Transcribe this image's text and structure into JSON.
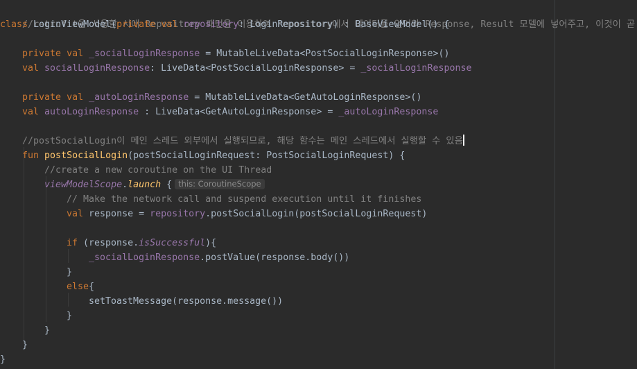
{
  "editor": {
    "background": "#2b2b2b",
    "colors": {
      "comment": "#808080",
      "keyword": "#cc7832",
      "property": "#9876aa",
      "function": "#ffc66d",
      "text": "#a9b7c6"
    },
    "lines": {
      "l1_comment": "//retrofit을 사용할 시에 Repository 패턴을 이용하여 repository에서 데이터를 얻어와 Response, Result 모델에 넣어주고, 이것이 곧 뷰모델이 됨",
      "l2_class_kw": "class",
      "l2_class_name": "LoginViewModel(",
      "l2_private": "private",
      "l2_val": "val",
      "l2_repo": "repository",
      "l2_rest": ": LoginRepository) : BaseViewModel() {",
      "l3_private": "private",
      "l3_val": "val",
      "l3_name": "_socialLoginResponse",
      "l3_rest": " = MutableLiveData<PostSocialLoginResponse>()",
      "l4_val": "val",
      "l4_name": "socialLoginResponse",
      "l4_mid": ": LiveData<PostSocialLoginResponse> = ",
      "l4_ref": "_socialLoginResponse",
      "l5_private": "private",
      "l5_val": "val",
      "l5_name": "_autoLoginResponse",
      "l5_rest": " = MutableLiveData<GetAutoLoginResponse>()",
      "l6_val": "val",
      "l6_name": "autoLoginResponse",
      "l6_mid": " : LiveData<GetAutoLoginResponse> = ",
      "l6_ref": "_autoLoginResponse",
      "l7_comment": "//postSocialLogin이 메인 스레드 외부에서 실행되므로, 해당 함수는 메인 스레드에서 실행할 수 있음",
      "l8_fun": "fun",
      "l8_name": "postSocialLogin",
      "l8_rest": "(postSocialLoginRequest: PostSocialLoginRequest) {",
      "l9_comment": "//create a new coroutine on the UI Thread",
      "l10_scope": "viewModelScope",
      "l10_dot": ".",
      "l10_launch": "launch",
      "l10_brace": " {",
      "l10_hint": "this: CoroutineScope",
      "l11_comment": "// Make the network call and suspend execution until it finishes",
      "l12_val": "val",
      "l12_mid": " response = ",
      "l12_repo": "repository",
      "l12_rest": ".postSocialLogin(postSocialLoginRequest)",
      "l13_if": "if",
      "l13_open": " (response.",
      "l13_prop": "isSuccessful",
      "l13_close": "){",
      "l14_name": "_socialLoginResponse",
      "l14_rest": ".postValue(response.body())",
      "l15_brace": "}",
      "l16_else": "else",
      "l16_brace": "{",
      "l17_text": "setToastMessage(response.message())",
      "l18_brace": "}",
      "l19_brace": "}",
      "l20_brace": "}",
      "l21_brace": "}"
    }
  }
}
